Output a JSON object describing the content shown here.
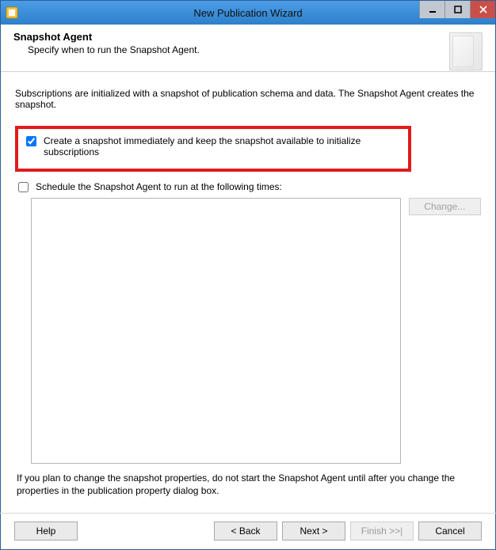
{
  "window": {
    "title": "New Publication Wizard"
  },
  "header": {
    "heading": "Snapshot Agent",
    "subtitle": "Specify when to run the Snapshot Agent."
  },
  "body": {
    "intro": "Subscriptions are initialized with a snapshot of publication schema and data. The Snapshot Agent creates the snapshot.",
    "checkbox_immediate": {
      "label": "Create a snapshot immediately and keep the snapshot available to initialize subscriptions",
      "checked": true
    },
    "checkbox_schedule": {
      "label": "Schedule the Snapshot Agent to run at the following times:",
      "checked": false
    },
    "change_button": "Change...",
    "footnote": "If you plan to change the snapshot properties, do not start the Snapshot Agent until after you change the properties in the publication property dialog box."
  },
  "buttons": {
    "help": "Help",
    "back": "< Back",
    "next": "Next >",
    "finish": "Finish >>|",
    "cancel": "Cancel"
  }
}
